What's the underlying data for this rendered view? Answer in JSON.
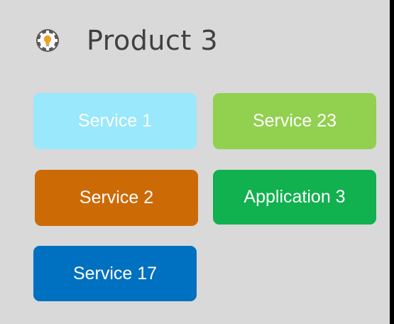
{
  "product": {
    "title": "Product 3",
    "icon": "gear-bulb-icon"
  },
  "tiles": [
    {
      "label": "Service 1",
      "color": "#99e8fb"
    },
    {
      "label": "Service 23",
      "color": "#92d050"
    },
    {
      "label": "Service 2",
      "color": "#cc6a06"
    },
    {
      "label": "Application 3",
      "color": "#10b14e"
    },
    {
      "label": "Service 17",
      "color": "#0070c0"
    }
  ]
}
